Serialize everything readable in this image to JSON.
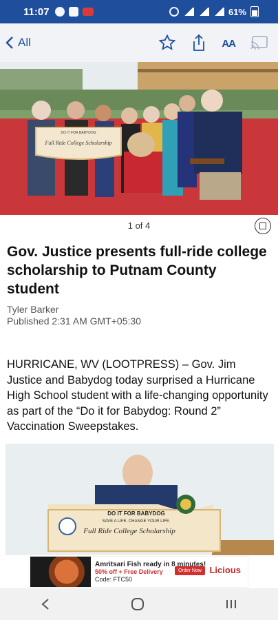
{
  "status": {
    "time": "11:07",
    "battery": "61%"
  },
  "nav": {
    "back_label": "All",
    "actions": [
      "star-icon",
      "share-icon",
      "text-size-icon",
      "cast-icon"
    ],
    "text_size_label": "AA"
  },
  "gallery": {
    "counter": "1 of 4"
  },
  "article": {
    "headline": "Gov. Justice presents full-ride college scholarship to Putnam County student",
    "author": "Tyler Barker",
    "published": "Published 2:31 AM GMT+05:30",
    "body": "HURRICANE, WV (LOOTPRESS) – Gov. Jim Justice and Babydog today surprised a Hurricane High School student with a life-changing opportunity as part of the “Do it for Babydog: Round 2” Vaccination Sweepstakes."
  },
  "photo2": {
    "sign_top": "DO IT FOR BABYDOG",
    "sign_sub": "SAVE A LIFE. CHANGE YOUR LIFE.",
    "sign_main": "Full Ride College Scholarship"
  },
  "hero": {
    "sign_text": "Full Ride College Scholarship",
    "sign_top": "DO IT FOR BABYDOG"
  },
  "ad": {
    "headline": "Amritsari Fish ready in 8 minutes!",
    "offer": "50% off + Free Delivery",
    "code": "Code: FTC50",
    "button": "Order Now",
    "brand": "Licious"
  },
  "colors": {
    "status_bar": "#1f4f9c",
    "accent": "#1f4f9c"
  }
}
